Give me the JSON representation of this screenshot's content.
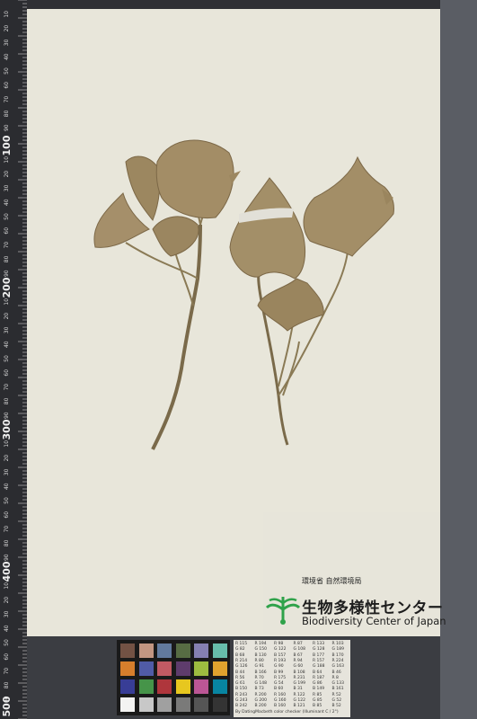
{
  "ruler": {
    "major_labels": [
      "100",
      "200",
      "300",
      "400",
      "500"
    ],
    "minor_labels": [
      "10",
      "20",
      "30",
      "40",
      "50",
      "60",
      "70",
      "80",
      "90"
    ]
  },
  "institution": {
    "agency_jp": "環境省 自然環境局",
    "name_jp": "生物多様性センター",
    "name_en": "Biodiversity Center of Japan",
    "logo": "plant-sprout-logo"
  },
  "color_card": {
    "caption": "By DatingMacbeth color checker (Illuminant C / 2°)",
    "table_rows": [
      [
        "R 115",
        "R 194",
        "R 98",
        "R 87",
        "R 133",
        "R 103"
      ],
      [
        "G 82",
        "G 150",
        "G 122",
        "G 108",
        "G 128",
        "G 189"
      ],
      [
        "B 68",
        "B 130",
        "B 157",
        "B 67",
        "B 177",
        "B 170"
      ],
      [
        "R 214",
        "R 80",
        "R 193",
        "R 94",
        "R 157",
        "R 224"
      ],
      [
        "G 126",
        "G 91",
        "G 90",
        "G 60",
        "G 188",
        "G 163"
      ],
      [
        "B 44",
        "B 166",
        "B 99",
        "B 108",
        "B 64",
        "B 46"
      ],
      [
        "R 56",
        "R 70",
        "R 175",
        "R 231",
        "R 187",
        "R 8"
      ],
      [
        "G 61",
        "G 148",
        "G 54",
        "G 199",
        "G 86",
        "G 133"
      ],
      [
        "B 150",
        "B 73",
        "B 60",
        "B 31",
        "B 149",
        "B 161"
      ],
      [
        "R 243",
        "R 200",
        "R 160",
        "R 122",
        "R 85",
        "R 52"
      ],
      [
        "G 243",
        "G 200",
        "G 160",
        "G 122",
        "G 85",
        "G 52"
      ],
      [
        "B 242",
        "B 200",
        "B 160",
        "B 121",
        "B 85",
        "B 52"
      ]
    ],
    "swatches": [
      "#735244",
      "#c29682",
      "#627a9d",
      "#576c43",
      "#8580b1",
      "#67bdaa",
      "#d67e2c",
      "#505ba6",
      "#c15a63",
      "#5e3c6c",
      "#9dbc40",
      "#e0a32e",
      "#383d96",
      "#469449",
      "#af363c",
      "#e7c71f",
      "#bb5695",
      "#0885a1",
      "#f3f3f2",
      "#c8c8c8",
      "#a0a0a0",
      "#7a7a79",
      "#555555",
      "#343434"
    ]
  }
}
